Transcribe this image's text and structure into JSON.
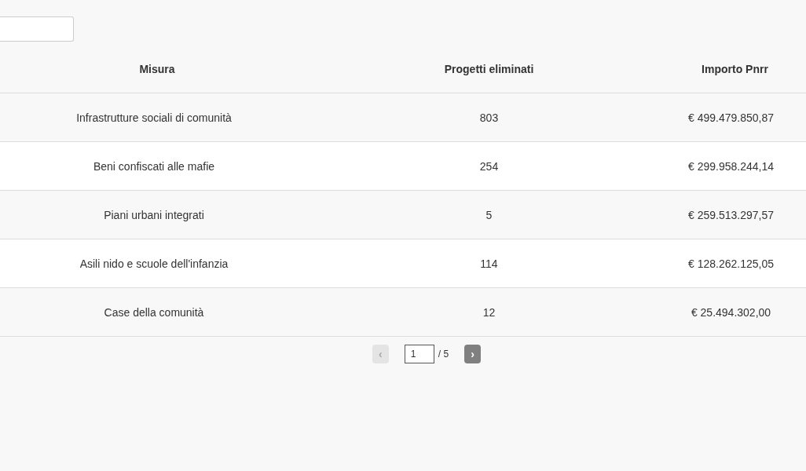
{
  "table": {
    "columns": [
      "Misura",
      "Progetti eliminati",
      "Importo Pnrr"
    ],
    "rows": [
      [
        "Infrastrutture sociali di comunità",
        "803",
        "€ 499.479.850,87"
      ],
      [
        "Beni confiscati alle mafie",
        "254",
        "€ 299.958.244,14"
      ],
      [
        "Piani urbani integrati",
        "5",
        "€ 259.513.297,57"
      ],
      [
        "Asili nido e scuole dell'infanzia",
        "114",
        "€ 128.262.125,05"
      ],
      [
        "Case della comunità",
        "12",
        "€ 25.494.302,00"
      ]
    ]
  },
  "pagination": {
    "prev": {
      "label": "‹",
      "disabled": true
    },
    "page": "1",
    "total": "/ 5",
    "next": {
      "label": "›",
      "disabled": false
    }
  }
}
